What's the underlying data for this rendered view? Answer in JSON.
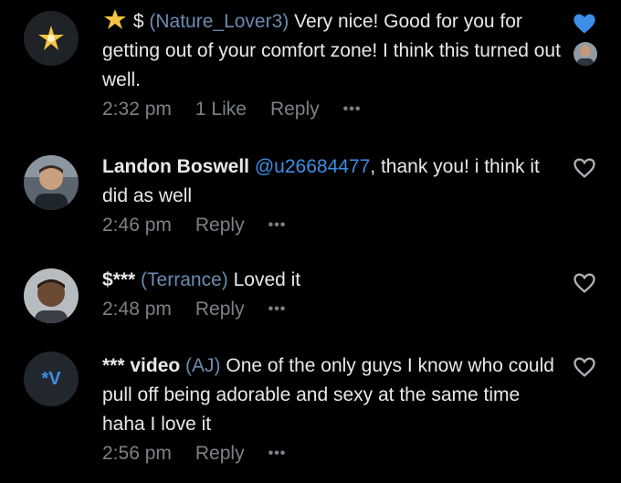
{
  "comments": [
    {
      "prefix": "$",
      "name": "(Nature_Lover3)",
      "text": " Very nice! Good for you for getting out of your comfort zone! I think this turned out well.",
      "time": "2:32 pm",
      "likes": "1 Like",
      "reply": "Reply",
      "more": "•••",
      "liked": true,
      "like_color": "#3d8ee6"
    },
    {
      "name": "Landon Boswell",
      "mention": "@u26684477",
      "text": ", thank you! i think it did as well",
      "time": "2:46 pm",
      "reply": "Reply",
      "more": "•••",
      "liked": false
    },
    {
      "name": "$***",
      "handle": "(Terrance)",
      "text": " Loved it",
      "time": "2:48 pm",
      "reply": "Reply",
      "more": "•••",
      "liked": false
    },
    {
      "avatar_text": "*V",
      "name": "*** video",
      "handle": "(AJ)",
      "text": " One of the only guys I know who could pull off being adorable and sexy at the same time haha I love it",
      "time": "2:56 pm",
      "reply": "Reply",
      "more": "•••",
      "liked": false
    }
  ]
}
